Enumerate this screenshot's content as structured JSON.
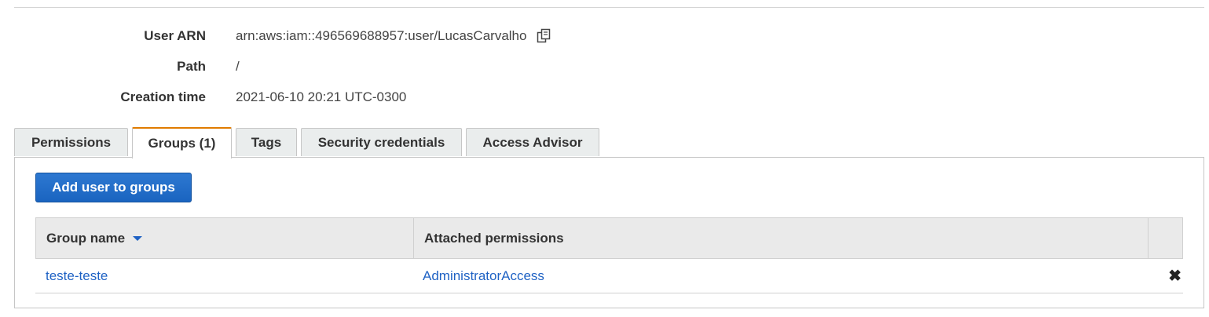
{
  "summary": {
    "user_arn_label": "User ARN",
    "user_arn_value": "arn:aws:iam::496569688957:user/LucasCarvalho",
    "path_label": "Path",
    "path_value": "/",
    "creation_time_label": "Creation time",
    "creation_time_value": "2021-06-10 20:21 UTC-0300",
    "copy_icon": "copy-icon"
  },
  "tabs": [
    {
      "label": "Permissions",
      "active": false
    },
    {
      "label": "Groups (1)",
      "active": true
    },
    {
      "label": "Tags",
      "active": false
    },
    {
      "label": "Security credentials",
      "active": false
    },
    {
      "label": "Access Advisor",
      "active": false
    }
  ],
  "groups_panel": {
    "add_button_label": "Add user to groups",
    "columns": [
      "Group name",
      "Attached permissions",
      ""
    ],
    "sort_icon": "sort-descending-icon",
    "rows": [
      {
        "group_name": "teste-teste",
        "attached_permissions": "AdministratorAccess",
        "remove_icon": "remove-icon"
      }
    ]
  },
  "colors": {
    "accent_tab": "#e07b00",
    "button_blue": "#1a64c0",
    "link_blue": "#1f62c4"
  }
}
